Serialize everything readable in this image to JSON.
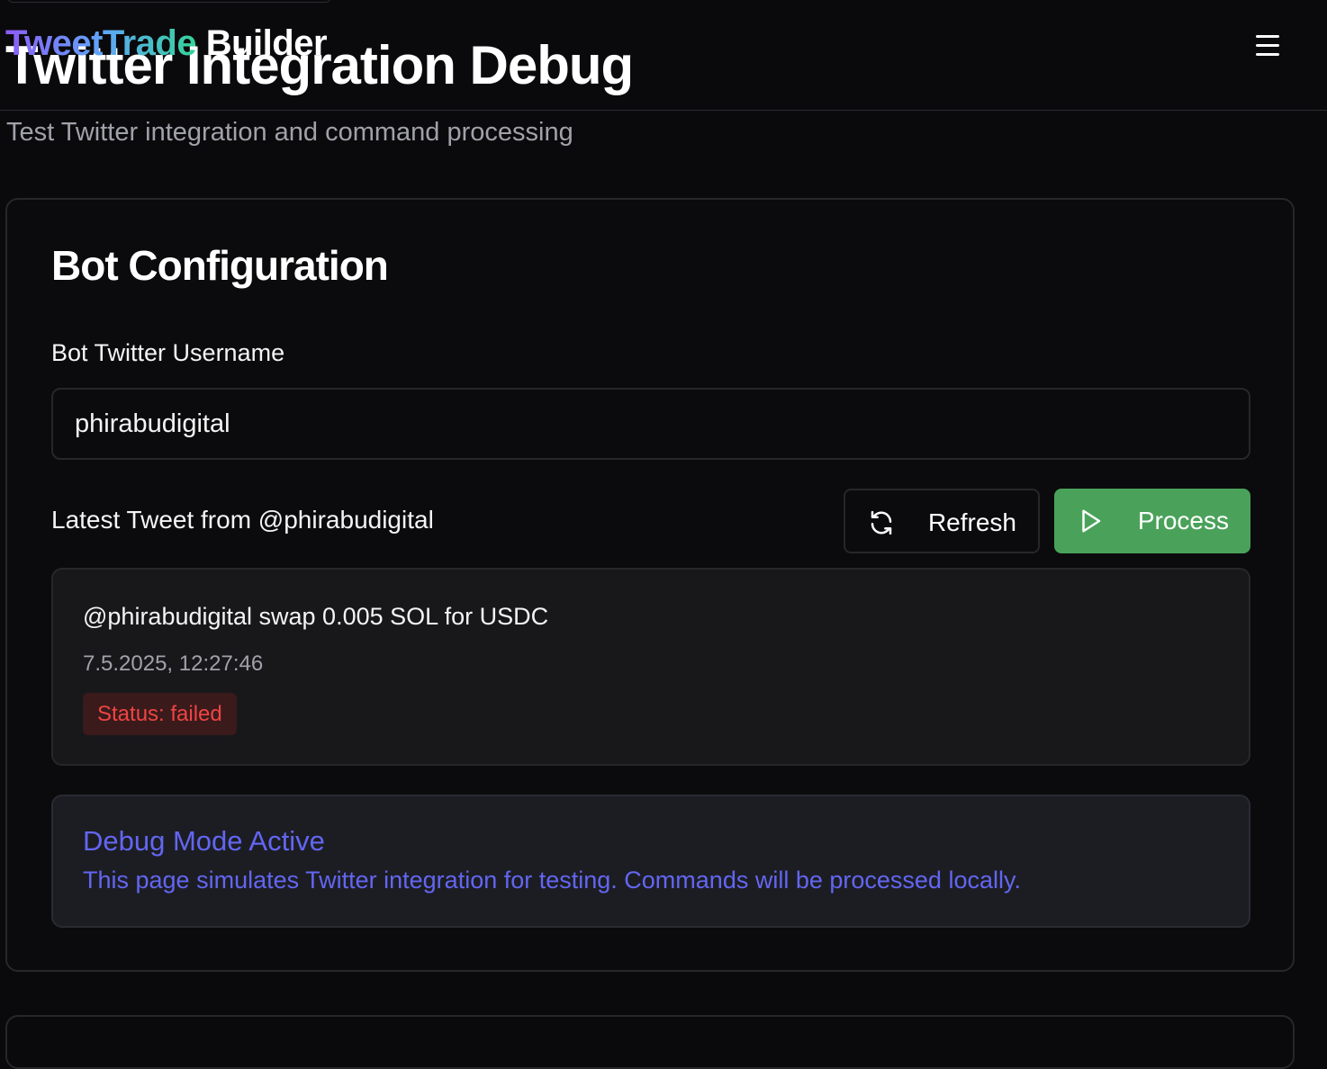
{
  "header": {
    "brand_accent": "TweetTrade",
    "brand_rest": " Builder",
    "menu_icon": "hamburger-menu-icon"
  },
  "page": {
    "title": "Twitter Integration Debug",
    "subtitle": "Test Twitter integration and command processing"
  },
  "bot_config": {
    "title": "Bot Configuration",
    "username_label": "Bot Twitter Username",
    "username_value": "phirabudigital",
    "latest_tweet_label": "Latest Tweet from @phirabudigital",
    "refresh_label": "Refresh",
    "refresh_icon": "refresh-icon",
    "process_label": "Process",
    "process_icon": "play-icon",
    "colors": {
      "process_button": "#4aa25a",
      "status_failed": "#ef4444",
      "debug_accent": "#6366f1"
    }
  },
  "tweet": {
    "text": "@phirabudigital swap 0.005 SOL for USDC",
    "timestamp": "7.5.2025, 12:27:46",
    "status": "Status: failed"
  },
  "debug": {
    "title": "Debug Mode Active",
    "message": "This page simulates Twitter integration for testing. Commands will be processed locally."
  }
}
